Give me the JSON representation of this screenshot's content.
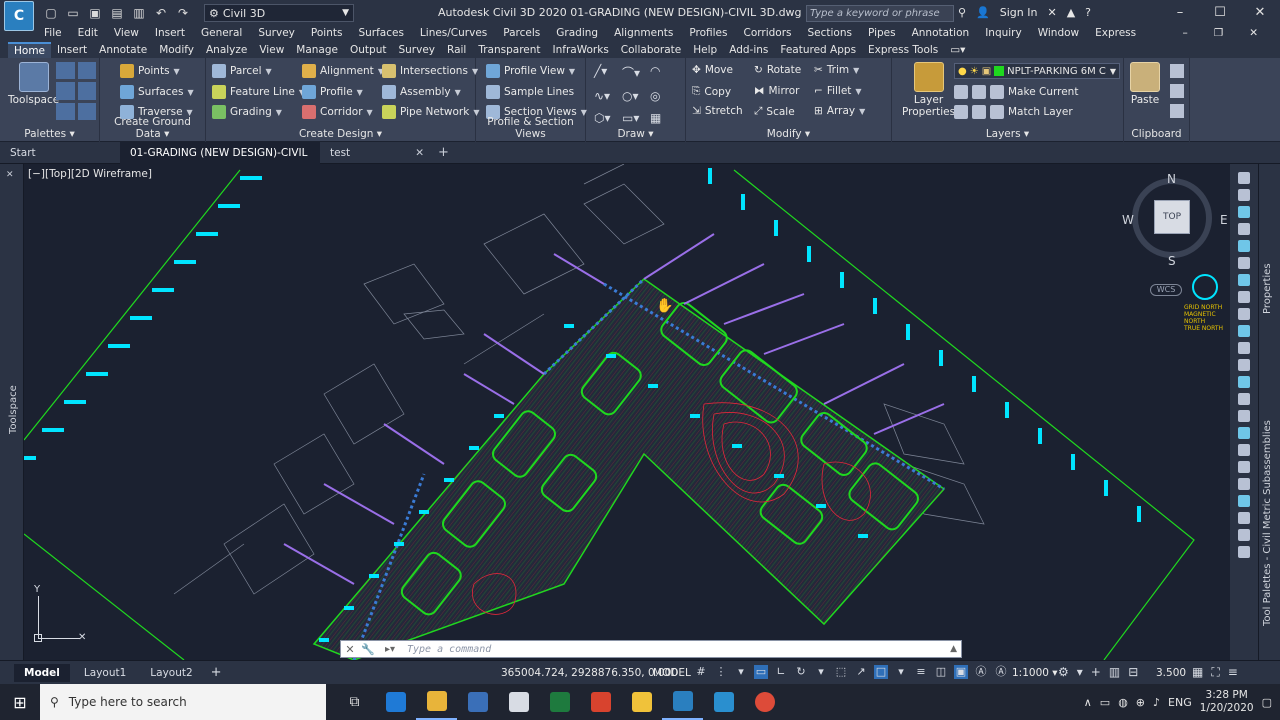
{
  "app": {
    "logo_text": "C",
    "logo_sub": "C3D",
    "title": "Autodesk Civil 3D 2020    01-GRADING (NEW DESIGN)-CIVIL 3D.dwg",
    "workspace": "Civil 3D",
    "search_placeholder": "Type a keyword or phrase",
    "sign_in": "Sign In"
  },
  "menu": [
    "File",
    "Edit",
    "View",
    "Insert",
    "General",
    "Survey",
    "Points",
    "Surfaces",
    "Lines/Curves",
    "Parcels",
    "Grading",
    "Alignments",
    "Profiles",
    "Corridors",
    "Sections",
    "Pipes",
    "Annotation",
    "Inquiry",
    "Window",
    "Express"
  ],
  "ribbon_tabs": [
    "Home",
    "Insert",
    "Annotate",
    "Modify",
    "Analyze",
    "View",
    "Manage",
    "Output",
    "Survey",
    "Rail",
    "Transparent",
    "InfraWorks",
    "Collaborate",
    "Help",
    "Add-ins",
    "Featured Apps",
    "Express Tools"
  ],
  "ribbon": {
    "palettes": {
      "title": "Palettes",
      "toolspace": "Toolspace"
    },
    "ground": {
      "title": "Create Ground Data",
      "points": "Points",
      "surfaces": "Surfaces",
      "traverse": "Traverse"
    },
    "design": {
      "title": "Create Design",
      "parcel": "Parcel",
      "feature_line": "Feature Line",
      "grading": "Grading",
      "alignment": "Alignment",
      "profile": "Profile",
      "corridor": "Corridor",
      "intersections": "Intersections",
      "assembly": "Assembly",
      "pipe_network": "Pipe Network"
    },
    "profile_views": {
      "title": "Profile & Section Views",
      "profile_view": "Profile View",
      "sample_lines": "Sample Lines",
      "section_views": "Section Views"
    },
    "draw": {
      "title": "Draw"
    },
    "modify": {
      "title": "Modify",
      "move": "Move",
      "rotate": "Rotate",
      "trim": "Trim",
      "copy": "Copy",
      "mirror": "Mirror",
      "fillet": "Fillet",
      "stretch": "Stretch",
      "scale": "Scale",
      "array": "Array"
    },
    "layers": {
      "title": "Layers",
      "layer_properties_1": "Layer",
      "layer_properties_2": "Properties",
      "current_layer": "NPLT-PARKING 6M C",
      "make_current": "Make Current",
      "match_layer": "Match Layer"
    },
    "clipboard": {
      "title": "Clipboard",
      "paste": "Paste"
    }
  },
  "doc_tabs": [
    {
      "label": "Start",
      "closable": false
    },
    {
      "label": "01-GRADING (NEW DESIGN)-CIVIL 3D*",
      "closable": true,
      "active": true
    },
    {
      "label": "test",
      "closable": true
    }
  ],
  "viewport": {
    "label": "[−][Top][2D Wireframe]",
    "compass": {
      "n": "N",
      "s": "S",
      "e": "E",
      "w": "W",
      "top": "TOP"
    },
    "wcs": "WCS",
    "north_a": "GRID NORTH",
    "north_b": "MAGNETIC NORTH",
    "north_c": "TRUE NORTH",
    "ucs_y": "Y"
  },
  "side": {
    "toolspace": "Toolspace",
    "properties": "Properties",
    "tool_palettes": "Tool Palettes - Civil Metric Subassemblies"
  },
  "command": {
    "placeholder": "Type a command"
  },
  "status": {
    "layouts": [
      "Model",
      "Layout1",
      "Layout2"
    ],
    "coords": "365004.724, 2928876.350, 0.000",
    "mode": "MODEL",
    "scale": "1:1000",
    "decimal": "3.500"
  },
  "taskbar": {
    "search_placeholder": "Type here to search",
    "lang": "ENG",
    "time": "3:28 PM",
    "date": "1/20/2020"
  },
  "colors": {
    "accent": "#4a8fd6",
    "site_green": "#1fd81f",
    "lot_cyan": "#00e5ff",
    "contour_red": "#e0283a",
    "grid_blue": "#3a7bd5",
    "purple": "#9a6fe8"
  }
}
